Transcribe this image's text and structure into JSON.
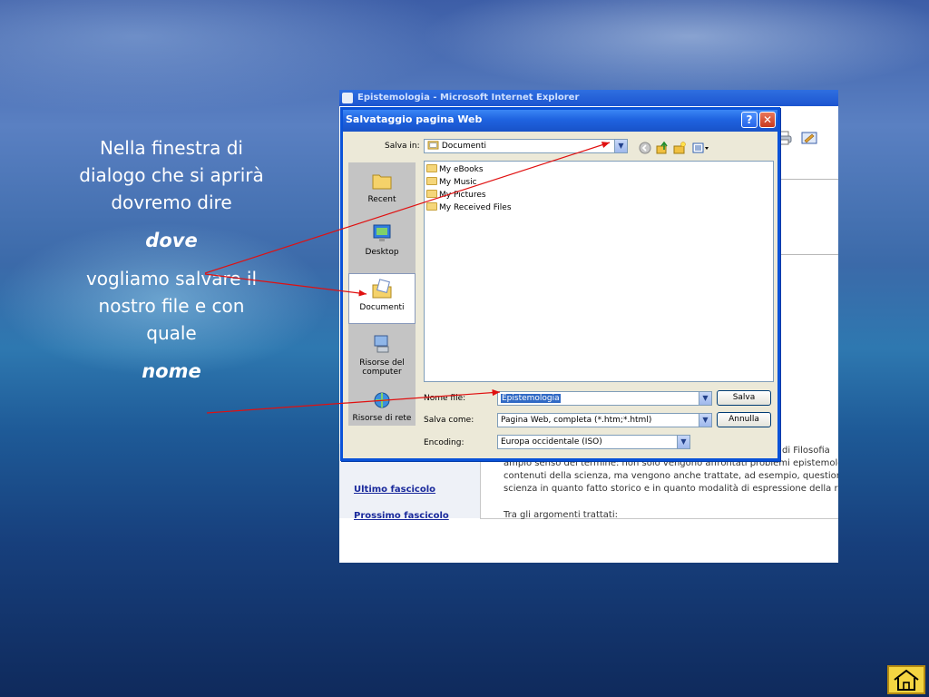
{
  "slide": {
    "line1": "Nella finestra di dialogo che si aprirà dovremo dire",
    "word_dove": "dove",
    "line2": "vogliamo salvare il nostro file e con quale",
    "word_nome": "nome"
  },
  "browser": {
    "title": "Epistemologia - Microsoft Internet Explorer",
    "links": [
      "Ultimo fascicolo",
      "Prossimo fascicolo"
    ],
    "body_lines": [
      "di Filosofia",
      "ampio senso del termine: non solo vengono affrontati problemi epistemolog",
      "contenuti della scienza, ma vengono anche trattate, ad esempio, question",
      "scienza in quanto fatto storico e in quanto  modalità di espressione della r",
      "Tra gli argomenti trattati:"
    ]
  },
  "dialog": {
    "title": "Salvataggio pagina Web",
    "help_label": "?",
    "close_label": "✕",
    "save_in_label": "Salva in:",
    "save_in_value": "Documenti",
    "places": [
      {
        "label": "Recent",
        "icon": "recent-folder-icon"
      },
      {
        "label": "Desktop",
        "icon": "desktop-icon"
      },
      {
        "label": "Documenti",
        "icon": "my-documents-icon"
      },
      {
        "label": "Risorse del computer",
        "icon": "my-computer-icon"
      },
      {
        "label": "Risorse di rete",
        "icon": "network-icon"
      }
    ],
    "files": [
      "My eBooks",
      "My Music",
      "My Pictures",
      "My Received Files"
    ],
    "filename_label": "Nome file:",
    "filename_value": "Epistemologia",
    "savetype_label": "Salva come:",
    "savetype_value": "Pagina Web, completa (*.htm;*.html)",
    "encoding_label": "Encoding:",
    "encoding_value": "Europa occidentale (ISO)",
    "save_button": "Salva",
    "cancel_button": "Annulla"
  },
  "colors": {
    "arrow": "#e01010",
    "dialog_border": "#0a52d8",
    "selection": "#316ac5"
  }
}
